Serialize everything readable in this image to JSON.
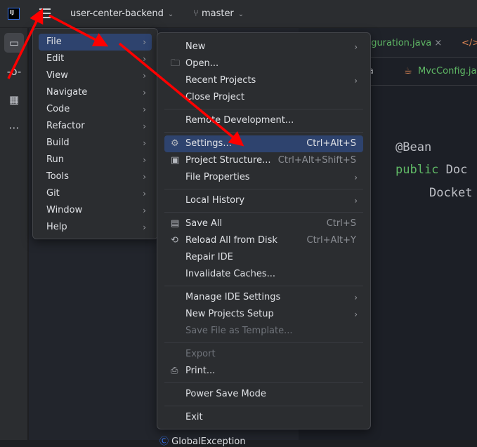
{
  "titlebar": {
    "logo": "IJ",
    "project": "user-center-backend",
    "branch": "master"
  },
  "editor": {
    "tab1": "figuration.java",
    "tab1_close": "×",
    "tab2_prefix": "a",
    "tab2": "MvcConfig.java",
    "code": [
      "@Bean",
      "public",
      "Doc",
      "Docket"
    ]
  },
  "tree": {
    "partial_item": "GlobalException"
  },
  "main_menu": [
    "File",
    "Edit",
    "View",
    "Navigate",
    "Code",
    "Refactor",
    "Build",
    "Run",
    "Tools",
    "Git",
    "Window",
    "Help"
  ],
  "file_menu": {
    "new": "New",
    "open": "Open...",
    "recent": "Recent Projects",
    "close": "Close Project",
    "remote": "Remote Development...",
    "settings": "Settings...",
    "settings_sc": "Ctrl+Alt+S",
    "structure": "Project Structure...",
    "structure_sc": "Ctrl+Alt+Shift+S",
    "props": "File Properties",
    "history": "Local History",
    "save": "Save All",
    "save_sc": "Ctrl+S",
    "reload": "Reload All from Disk",
    "reload_sc": "Ctrl+Alt+Y",
    "repair": "Repair IDE",
    "invalidate": "Invalidate Caches...",
    "manage": "Manage IDE Settings",
    "newsetup": "New Projects Setup",
    "template": "Save File as Template...",
    "export": "Export",
    "print": "Print...",
    "power": "Power Save Mode",
    "exit": "Exit"
  },
  "colors": {
    "selection": "#2e436e",
    "annotation_arrow": "#ff0000",
    "keyword": "#5fb865"
  }
}
